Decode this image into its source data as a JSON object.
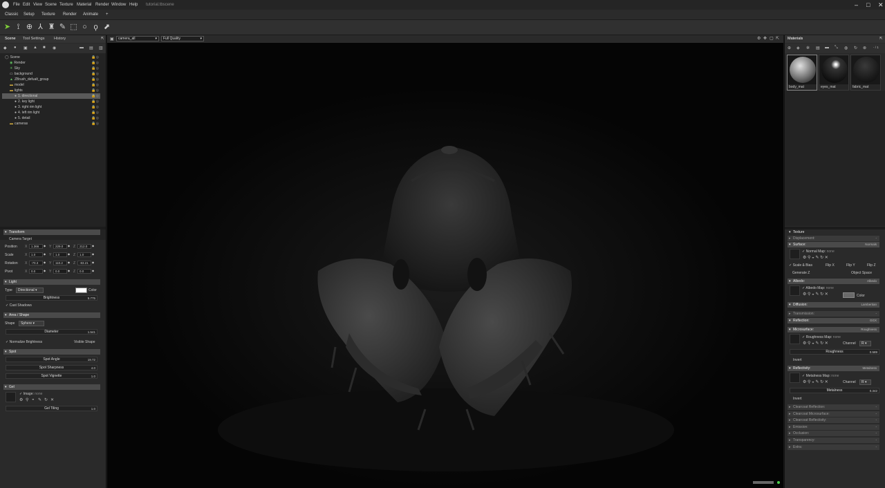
{
  "window": {
    "title": "tutorial.tbscene",
    "menu": [
      "File",
      "Edit",
      "View",
      "Scene",
      "Texture",
      "Material",
      "Render",
      "Window",
      "Help"
    ]
  },
  "workspace_tabs": [
    "Classic",
    "Setup",
    "Texture",
    "Render",
    "Animate",
    "+"
  ],
  "left_panel": {
    "tabs": [
      "Scene",
      "Tool Settings",
      "History"
    ],
    "tree": [
      {
        "label": "Scene",
        "indent": 0,
        "type": "scene"
      },
      {
        "label": "Render",
        "indent": 1,
        "type": "render"
      },
      {
        "label": "Sky",
        "indent": 1,
        "type": "sky"
      },
      {
        "label": "background",
        "indent": 1,
        "type": "bg"
      },
      {
        "label": "ZBrush_defualt_group",
        "indent": 1,
        "type": "mesh"
      },
      {
        "label": "model",
        "indent": 1,
        "type": "folder"
      },
      {
        "label": "lights",
        "indent": 1,
        "type": "folder"
      },
      {
        "label": "1. directional",
        "indent": 2,
        "type": "light",
        "selected": true
      },
      {
        "label": "2. key light",
        "indent": 2,
        "type": "light"
      },
      {
        "label": "3. right rim light",
        "indent": 2,
        "type": "light"
      },
      {
        "label": "4. left rim light",
        "indent": 2,
        "type": "light"
      },
      {
        "label": "5. detail",
        "indent": 2,
        "type": "light"
      },
      {
        "label": "cameras",
        "indent": 1,
        "type": "folder"
      }
    ],
    "transform": {
      "header": "Transform",
      "camera_target": "Camera Target",
      "rows": [
        {
          "label": "Position",
          "x": "1.366",
          "y": "229.0",
          "z": "212.0"
        },
        {
          "label": "Scale",
          "x": "1.0",
          "y": "1.0",
          "z": "1.0"
        },
        {
          "label": "Rotation",
          "x": "-70.3",
          "y": "110.2",
          "z": "-83.21"
        },
        {
          "label": "Pivot",
          "x": "0.0",
          "y": "0.0",
          "z": "0.0"
        }
      ]
    },
    "light": {
      "header": "Light",
      "type_label": "Type",
      "type_value": "Directional",
      "color_label": "Color",
      "brightness_label": "Brightness",
      "brightness_value": "5.775",
      "cast_shadows": "Cast Shadows"
    },
    "area": {
      "header": "Area / Shape",
      "shape_label": "Shape",
      "shape_value": "Sphere",
      "diameter_label": "Diameter",
      "diameter_value": "1.541",
      "normalize": "Normalize Brightness",
      "visible_shape": "Visible Shape"
    },
    "spot": {
      "header": "Spot",
      "rows": [
        {
          "label": "Spot Angle",
          "value": "19.72"
        },
        {
          "label": "Spot Sharpness",
          "value": "4.0"
        },
        {
          "label": "Spot Vignette",
          "value": "1.0"
        }
      ]
    },
    "gel": {
      "header": "Gel",
      "image_label": "Image:",
      "image_value": "none",
      "tiling_label": "Gel Tiling",
      "tiling_value": "1.0"
    }
  },
  "viewport": {
    "camera": "camera_all",
    "quality": "Full Quality"
  },
  "right_panel": {
    "tab": "Materials",
    "page": "- / 1",
    "materials": [
      {
        "name": "body_mat"
      },
      {
        "name": "eyes_mat"
      },
      {
        "name": "fabric_mat"
      }
    ],
    "texture_label": "Texture",
    "displacement": {
      "label": "Displacement:",
      "value": "-"
    },
    "surface": {
      "label": "Surface:",
      "value": "Normals"
    },
    "normal_map": {
      "label": "Normal Map:",
      "value": "none"
    },
    "scale_bias": "Scale & Bias",
    "flip_x": "Flip X",
    "flip_y": "Flip Y",
    "flip_z": "Flip Z",
    "generate_z": "Generate Z",
    "object_space": "Object Space",
    "albedo": {
      "label": "Albedo:",
      "value": "Albedo"
    },
    "albedo_map": {
      "label": "Albedo Map:",
      "value": "none"
    },
    "color_label": "Color",
    "diffusion": {
      "label": "Diffusion:",
      "value": "Lambertian"
    },
    "transmission": {
      "label": "Transmission:",
      "value": "-"
    },
    "reflection": {
      "label": "Reflection:",
      "value": "GGX"
    },
    "microsurface": {
      "label": "Microsurface:",
      "value": "Roughness"
    },
    "roughness_map": {
      "label": "Roughness Map:",
      "value": "none"
    },
    "channel_label": "Channel",
    "channel_value": "R",
    "roughness": {
      "label": "Roughness",
      "value": "0.589"
    },
    "invert": "Invert",
    "reflectivity": {
      "label": "Reflectivity:",
      "value": "Metalness"
    },
    "metalness_map": {
      "label": "Metalness Map:",
      "value": "none"
    },
    "metalness": {
      "label": "Metalness",
      "value": "0.342"
    },
    "collapsed": [
      {
        "label": "Clearcoat Reflection:",
        "value": "-"
      },
      {
        "label": "Clearcoat Microsurface:",
        "value": "-"
      },
      {
        "label": "Clearcoat Reflectivity:",
        "value": "-"
      },
      {
        "label": "Emission:",
        "value": "-"
      },
      {
        "label": "Occlusion:",
        "value": "-"
      },
      {
        "label": "Transparency:",
        "value": "-"
      },
      {
        "label": "Extra:",
        "value": "-"
      }
    ]
  }
}
